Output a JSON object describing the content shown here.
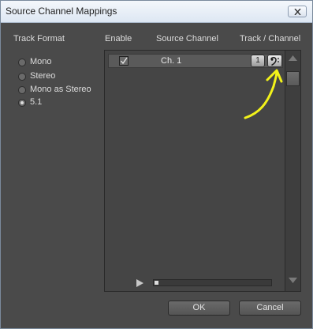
{
  "window": {
    "title": "Source Channel Mappings"
  },
  "left_panel": {
    "heading": "Track Format",
    "options": [
      {
        "label": "Mono",
        "checked": false
      },
      {
        "label": "Stereo",
        "checked": false
      },
      {
        "label": "Mono as Stereo",
        "checked": false
      },
      {
        "label": "5.1",
        "checked": true
      }
    ]
  },
  "table": {
    "headers": {
      "enable": "Enable",
      "source": "Source Channel",
      "track": "Track / Channel"
    },
    "rows": [
      {
        "enabled": true,
        "source_channel": "Ch. 1",
        "track": "1",
        "channel_icon": "bass-clef-icon"
      }
    ]
  },
  "buttons": {
    "ok": "OK",
    "cancel": "Cancel"
  },
  "colors": {
    "annotation": "#f2f21a",
    "panel": "#4a4a4a"
  }
}
